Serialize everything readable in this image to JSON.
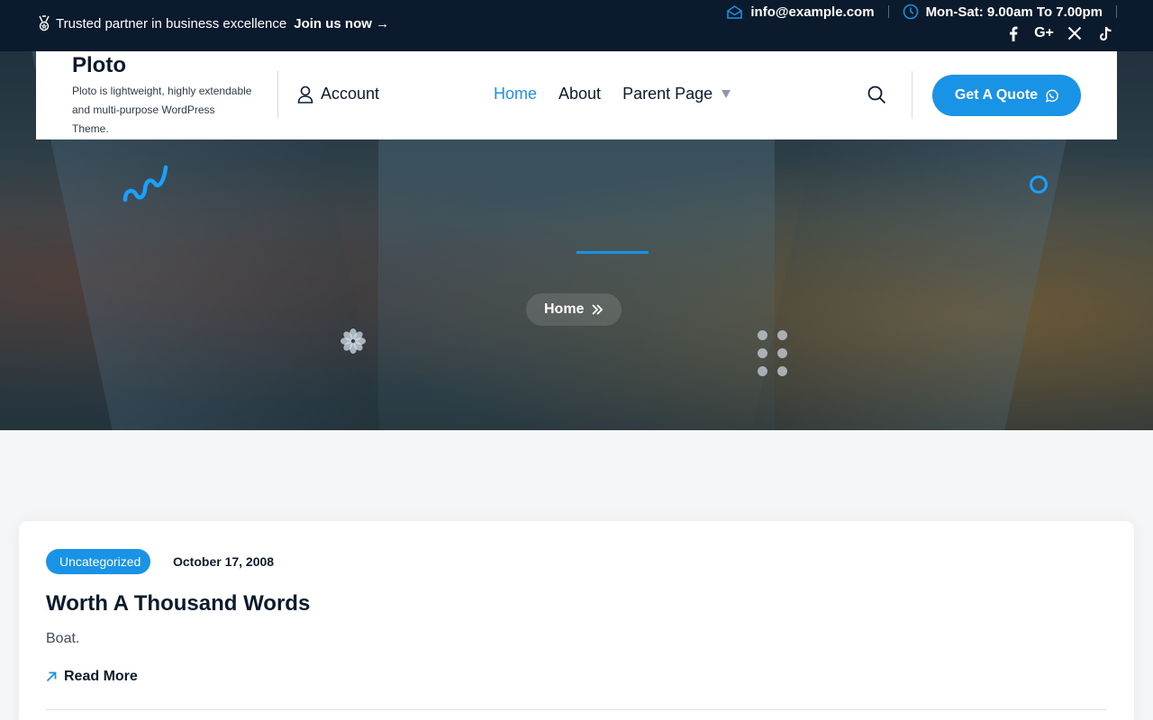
{
  "topbar": {
    "tagline": "Trusted partner in business excellence",
    "join_label": "Join us now →",
    "email": "info@example.com",
    "hours": "Mon-Sat: 9.00am To 7.00pm",
    "social": [
      "facebook-icon",
      "google-plus-icon",
      "x-icon",
      "tiktok-icon"
    ]
  },
  "header": {
    "site_name": "Ploto",
    "site_tagline": "Ploto is lightweight, highly extendable and multi-purpose WordPress Theme.",
    "account_label": "Account",
    "nav": {
      "home": "Home",
      "about": "About",
      "parent_page": "Parent Page"
    },
    "quote_label": "Get A Quote"
  },
  "hero": {
    "breadcrumb_home": "Home"
  },
  "post": {
    "category": "Uncategorized",
    "date": "October 17, 2008",
    "title": "Worth A Thousand Words",
    "excerpt": "Boat.",
    "read_more": "Read More"
  },
  "colors": {
    "accent": "#1893e6",
    "topbar_bg": "#0b1a2c"
  }
}
